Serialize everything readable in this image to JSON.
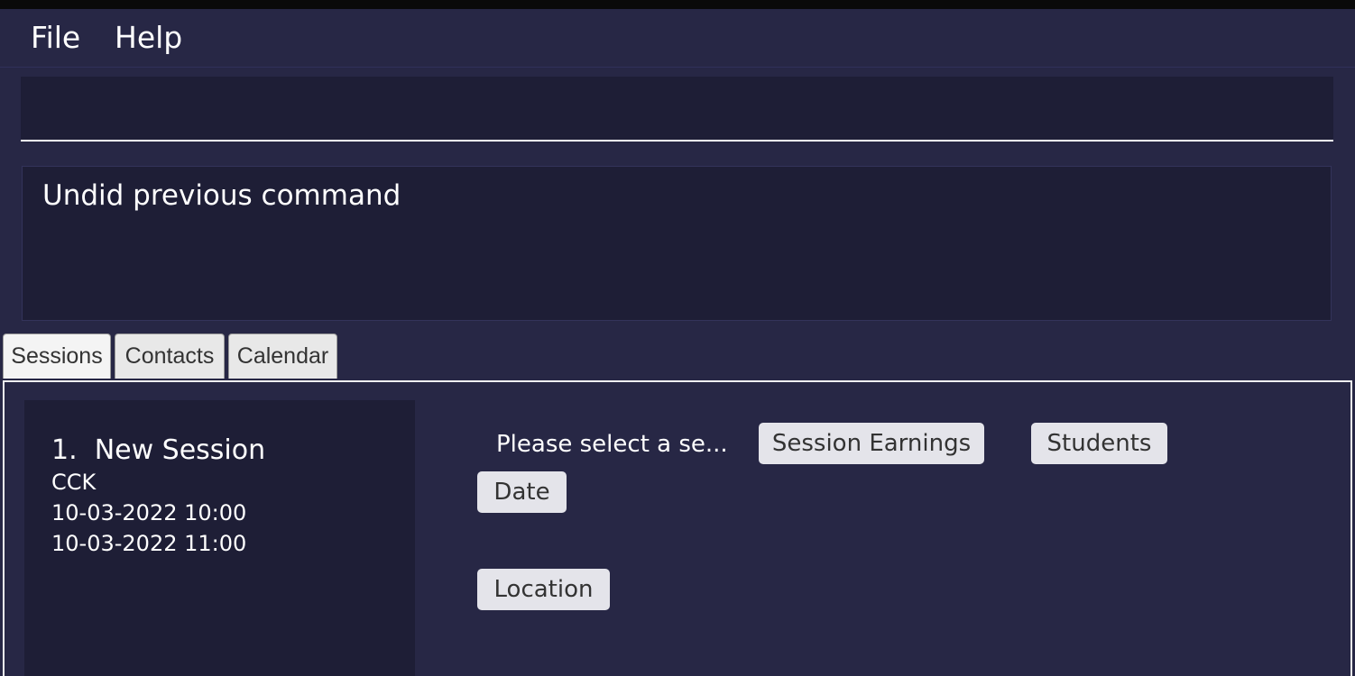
{
  "menu": {
    "file": "File",
    "help": "Help"
  },
  "command": {
    "value": "",
    "placeholder": ""
  },
  "result": {
    "message": "Undid previous command"
  },
  "tabs": [
    {
      "label": "Sessions",
      "selected": true
    },
    {
      "label": "Contacts",
      "selected": false
    },
    {
      "label": "Calendar",
      "selected": false
    }
  ],
  "sessions": [
    {
      "index": "1.",
      "name": "New Session",
      "location": "CCK",
      "start": "10-03-2022 10:00",
      "end": "10-03-2022 11:00"
    }
  ],
  "details": {
    "prompt": "Please select a se...",
    "session_earnings": "Session Earnings",
    "students": "Students",
    "date": "Date",
    "location": "Location"
  },
  "colors": {
    "background": "#272745",
    "panel": "#1e1e36",
    "text": "#ffffff",
    "pill": "#e4e4ea"
  }
}
